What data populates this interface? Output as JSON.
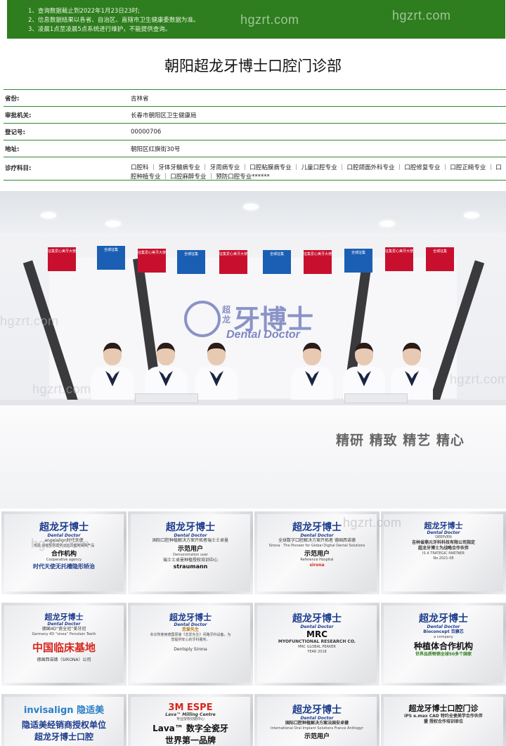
{
  "notice": {
    "lines": [
      "1、查询数据截止到2022年1月23日23时;",
      "2、信息数据结果以各省、自治区、直辖市卫生健康委数据为准。",
      "3、凌晨1点至凌晨5点系统进行维护，不能提供查询。"
    ]
  },
  "watermark": "hgzrt.com",
  "page_title": "朝阳超龙牙博士口腔门诊部",
  "info": {
    "province": {
      "label": "省份:",
      "value": "吉林省"
    },
    "authority": {
      "label": "审批机关:",
      "value": "长春市朝阳区卫生健康局"
    },
    "reg_no": {
      "label": "登记号:",
      "value": "00000706"
    },
    "address": {
      "label": "地址:",
      "value": "朝阳区红旗街30号"
    },
    "subjects": {
      "label": "诊疗科目:",
      "value": "口腔科 ｜ 牙体牙髓病专业 ｜ 牙周病专业 ｜ 口腔粘膜病专业 ｜ 儿童口腔专业 ｜ 口腔颌面外科专业 ｜ 口腔修复专业 ｜ 口腔正畸专业 ｜ 口腔种植专业 ｜ 口腔麻醉专业 ｜ 预防口腔专业******"
    }
  },
  "photo": {
    "logo_main": "牙博士",
    "logo_vertical": "超龙",
    "logo_sub": "Dental Doctor",
    "slogan": "精研 精致 精艺 精心",
    "flags": [
      "征集爱心美牙大使",
      "全城征集",
      "征集爱心美牙大使",
      "全城征集",
      "征集爱心美牙大使",
      "全城征集",
      "征集爱心美牙大使",
      "全城征集",
      "征集爱心美牙大使",
      "全城征集"
    ]
  },
  "plaques": [
    {
      "brand": "超龙牙博士",
      "brand_sub": "Dental Doctor",
      "top": "angelalign时代天使",
      "mid": "体验·训练规则案例运动员健身保障产品",
      "title": "合作机构",
      "en": "Cooperative agency",
      "bottom": "时代天使无托槽隐形矫治"
    },
    {
      "brand": "超龙牙博士",
      "brand_sub": "Dental Doctor",
      "top": "国际口腔种植解决方案开拓者瑞士士卓曼",
      "mid": "示范用户",
      "en": "Demonstration user",
      "title": "瑞士士卓曼种植授权培训中心",
      "bottom": "straumann"
    },
    {
      "brand": "超龙牙博士",
      "brand_sub": "Dental Doctor",
      "top": "全球数字口腔解决方案开拓者 德国西诺德",
      "mid": "Sirona · The Pioneer for Global Digital Dental Solutions",
      "title": "示范用户",
      "en": "Reference Hospital",
      "bottom": "sirona"
    },
    {
      "brand": "超龙牙博士",
      "brand_sub": "Dental Doctor",
      "top": "DEEPVEN",
      "mid": "吉林省鼎元牙科科技有限公司指定",
      "title": "超龙牙博士为战略合作伙伴",
      "en": "IS A TRATEGIC PARTNER",
      "bottom": "No.2021-08"
    },
    {
      "brand": "超龙牙博士",
      "brand_sub": "Dental Doctor",
      "top": "德国4D“瓷全冠”美牙冠",
      "mid": "Germany 4D “sinea” Porcelain Teeth",
      "title": "中国临床基地",
      "en": "",
      "bottom": "德国西诺德（SIRONA）公司"
    },
    {
      "brand": "超龙牙博士",
      "brand_sub": "Dental Doctor",
      "top": "恋爱先生",
      "mid": "本诊所使用德国原装《恋爱先生》问路牙科设备，为",
      "title": "您提供安心的牙科服务。",
      "en": "",
      "bottom": "Dentsply Sirona"
    },
    {
      "brand": "超龙牙博士",
      "brand_sub": "Dental Doctor",
      "top": "MRC",
      "mid": "MYOFUNCTIONAL RESEARCH CO.",
      "title": "MRC GLOBAL PEAKER",
      "en": "YEAR 2018",
      "bottom": ""
    },
    {
      "brand": "超龙牙博士",
      "brand_sub": "Dental Doctor",
      "top": "Bioconcept 百康芯",
      "mid": "a company",
      "title": "种植体合作机构",
      "en": "",
      "bottom": "世界品质畅销全球50多个国家"
    },
    {
      "brand": "invisalign 隐适美",
      "brand_sub": "",
      "top": "",
      "mid": "",
      "title": "隐适美经销商授权单位",
      "en": "",
      "bottom": "超龙牙博士口腔"
    },
    {
      "brand": "3M ESPE",
      "brand_sub": "Lava™ Milling Centre",
      "top": "专业授权切削中心",
      "mid": "Lava™ 数字全瓷牙",
      "title": "世界第一品牌",
      "en": "",
      "bottom": ""
    },
    {
      "brand": "超龙牙博士",
      "brand_sub": "Dental Doctor",
      "top": "国际口腔种植解决方案法国安卓健",
      "mid": "International Oral Implant Solutions France Anthogyr",
      "title": "示范用户",
      "en": "",
      "bottom": ""
    },
    {
      "brand": "超龙牙博士口腔门诊",
      "brand_sub": "",
      "top": "IPS e.max CAD 特约全瓷美学合作伙伴",
      "mid": "",
      "title": "暨 授权合作培训单位",
      "en": "",
      "bottom": ""
    }
  ]
}
